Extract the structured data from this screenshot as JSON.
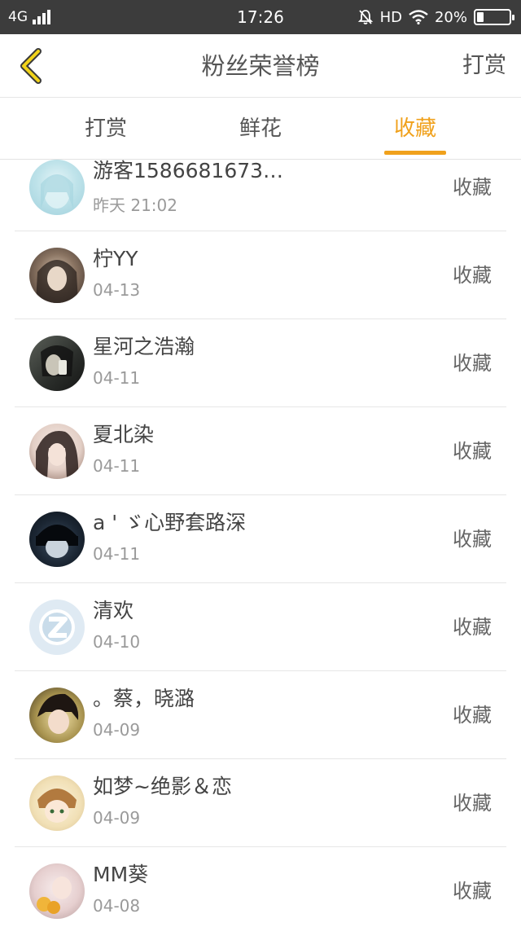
{
  "status_bar": {
    "network": "4G",
    "time": "17:26",
    "hd": "HD",
    "battery_percent": "20%",
    "battery_level": 0.2
  },
  "header": {
    "title": "粉丝荣誉榜",
    "action": "打赏",
    "back_icon": "chevron-left-icon"
  },
  "tabs": [
    {
      "label": "打赏",
      "active": false
    },
    {
      "label": "鲜花",
      "active": false
    },
    {
      "label": "收藏",
      "active": true
    }
  ],
  "colors": {
    "accent": "#f0a11c",
    "status_bar": "#3c3c3c",
    "text": "#444444",
    "muted": "#9a9a9a"
  },
  "list": [
    {
      "name": "游客1586681673…",
      "time": "昨天 21:02",
      "action": "收藏"
    },
    {
      "name": "柠YY",
      "time": "04-13",
      "action": "收藏"
    },
    {
      "name": "星河之浩瀚",
      "time": "04-11",
      "action": "收藏"
    },
    {
      "name": "夏北染",
      "time": "04-11",
      "action": "收藏"
    },
    {
      "name": "a ' ゞ心野套路深",
      "time": "04-11",
      "action": "收藏"
    },
    {
      "name": "清欢",
      "time": "04-10",
      "action": "收藏"
    },
    {
      "name": "。蔡，晓潞",
      "time": "04-09",
      "action": "收藏"
    },
    {
      "name": "如梦~绝影＆恋",
      "time": "04-09",
      "action": "收藏"
    },
    {
      "name": "MM葵",
      "time": "04-08",
      "action": "收藏"
    }
  ]
}
